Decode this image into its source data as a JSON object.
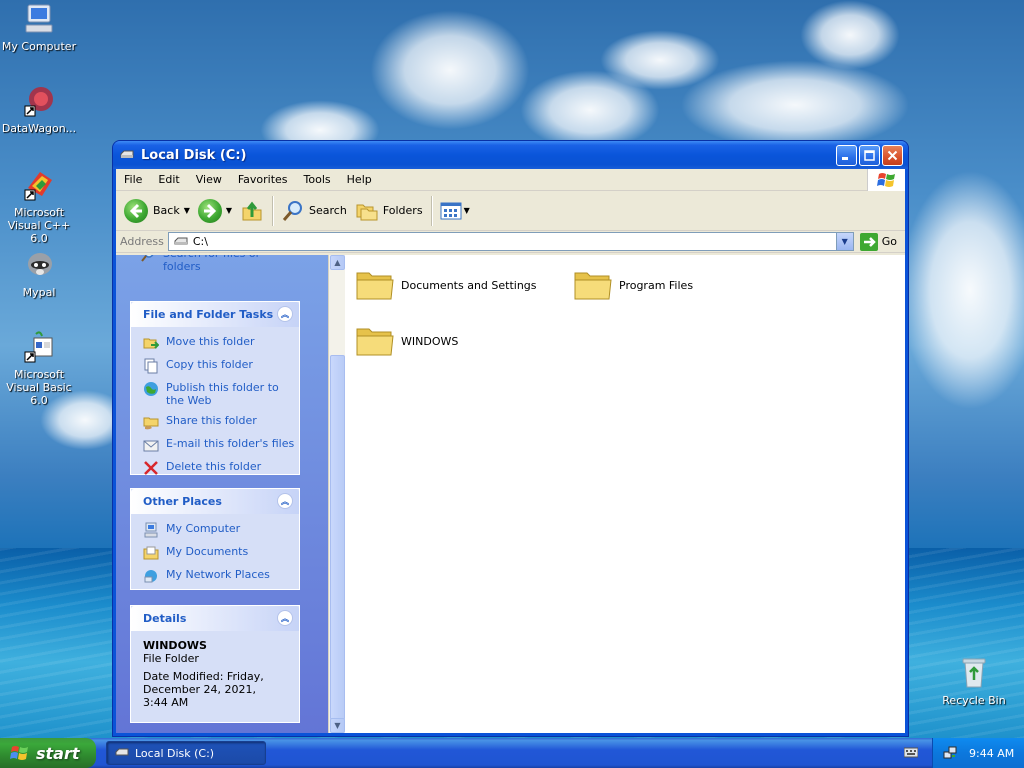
{
  "desktop": {
    "icons": [
      {
        "label": "My Computer"
      },
      {
        "label": "DataWagon..."
      },
      {
        "label": "Microsoft Visual C++ 6.0"
      },
      {
        "label": "Mypal"
      },
      {
        "label": "Microsoft Visual Basic 6.0"
      },
      {
        "label": "Recycle Bin"
      }
    ]
  },
  "window": {
    "title": "Local Disk (C:)",
    "menu": [
      "File",
      "Edit",
      "View",
      "Favorites",
      "Tools",
      "Help"
    ],
    "toolbar": {
      "back_label": "Back",
      "search_label": "Search",
      "folders_label": "Folders"
    },
    "address": {
      "label": "Address",
      "value": "C:\\",
      "go_label": "Go"
    },
    "left_pane": {
      "search_partial": "Search for files or folders",
      "file_tasks": {
        "title": "File and Folder Tasks",
        "items": [
          "Move this folder",
          "Copy this folder",
          "Publish this folder to the Web",
          "Share this folder",
          "E-mail this folder's files",
          "Delete this folder"
        ]
      },
      "other_places": {
        "title": "Other Places",
        "items": [
          "My Computer",
          "My Documents",
          "My Network Places"
        ]
      },
      "details": {
        "title": "Details",
        "name": "WINDOWS",
        "type": "File Folder",
        "modified": "Date Modified: Friday, December 24, 2021, 3:44 AM"
      }
    },
    "folders": [
      "Documents and Settings",
      "Program Files",
      "WINDOWS"
    ]
  },
  "taskbar": {
    "start_label": "start",
    "task_item": "Local Disk (C:)",
    "clock": "9:44 AM"
  }
}
